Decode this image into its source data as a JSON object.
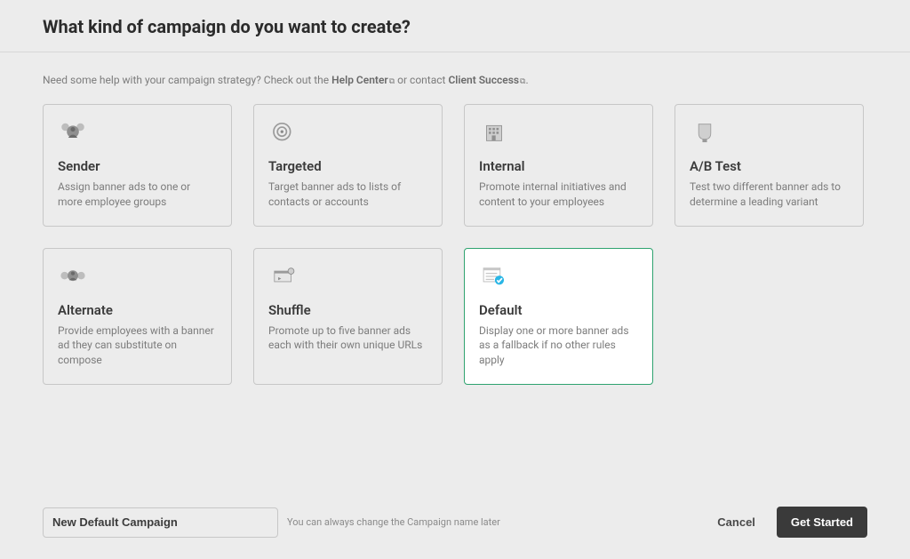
{
  "header": {
    "title": "What kind of campaign do you want to create?"
  },
  "hint": {
    "prefix": "Need some help with your campaign strategy? Check out the ",
    "help_link": "Help Center",
    "middle": " or contact ",
    "success_link": "Client Success",
    "suffix": "."
  },
  "cards": {
    "sender": {
      "title": "Sender",
      "desc": "Assign banner ads to one or more employee groups",
      "selected": false
    },
    "targeted": {
      "title": "Targeted",
      "desc": "Target banner ads to lists of contacts or accounts",
      "selected": false
    },
    "internal": {
      "title": "Internal",
      "desc": "Promote internal initiatives and content to your employees",
      "selected": false
    },
    "abtest": {
      "title": "A/B Test",
      "desc": "Test two different banner ads to determine a leading variant",
      "selected": false
    },
    "alternate": {
      "title": "Alternate",
      "desc": "Provide employees with a banner ad they can substitute on compose",
      "selected": false
    },
    "shuffle": {
      "title": "Shuffle",
      "desc": "Promote up to five banner ads each with their own unique URLs",
      "selected": false
    },
    "default": {
      "title": "Default",
      "desc": "Display one or more banner ads as a fallback if no other rules apply",
      "selected": true
    }
  },
  "footer": {
    "campaign_name": "New Default Campaign",
    "name_hint": "You can always change the Campaign name later",
    "cancel_label": "Cancel",
    "primary_label": "Get Started"
  }
}
